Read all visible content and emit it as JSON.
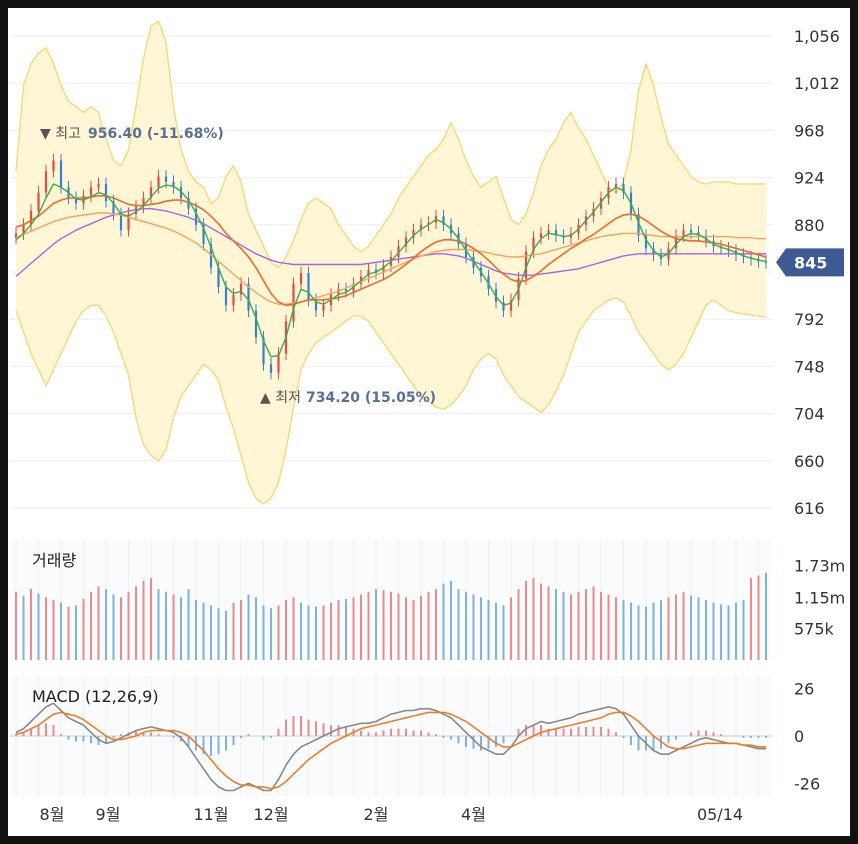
{
  "chart_data": [
    {
      "type": "candlestick",
      "panel": "price",
      "ylim": [
        616,
        1056
      ],
      "yticks": [
        "1,056",
        "1,012",
        "968",
        "924",
        "880",
        "845",
        "792",
        "748",
        "704",
        "660",
        "616"
      ],
      "current_price_label": "845",
      "current_price": 845,
      "x_months": [
        "8월",
        "9월",
        "11월",
        "12월",
        "2월",
        "4월",
        "05/14"
      ],
      "high_annotation": {
        "marker": "▼",
        "prefix": "최고",
        "value": "956.40 (-11.68%)"
      },
      "low_annotation": {
        "marker": "▲",
        "prefix": "최저",
        "value": "734.20 (15.05%)"
      },
      "close_points": [
        872,
        880,
        893,
        910,
        930,
        940,
        915,
        905,
        900,
        907,
        915,
        918,
        902,
        890,
        875,
        890,
        897,
        905,
        915,
        925,
        920,
        915,
        905,
        895,
        880,
        862,
        840,
        822,
        805,
        815,
        825,
        800,
        775,
        750,
        742,
        760,
        790,
        825,
        835,
        810,
        800,
        805,
        815,
        820,
        818,
        825,
        832,
        838,
        835,
        842,
        850,
        860,
        868,
        875,
        880,
        882,
        888,
        880,
        872,
        862,
        850,
        840,
        832,
        820,
        808,
        800,
        810,
        830,
        855,
        868,
        872,
        875,
        870,
        868,
        872,
        880,
        888,
        895,
        905,
        915,
        918,
        910,
        890,
        870,
        858,
        852,
        848,
        858,
        870,
        875,
        873,
        870,
        865,
        860,
        858,
        856,
        852,
        850,
        848,
        846,
        845
      ],
      "ma_short": [
        866,
        872,
        880,
        890,
        905,
        918,
        915,
        910,
        904,
        903,
        906,
        910,
        908,
        900,
        890,
        888,
        892,
        898,
        906,
        914,
        917,
        916,
        911,
        903,
        891,
        877,
        859,
        840,
        822,
        816,
        818,
        810,
        793,
        772,
        757,
        758,
        775,
        802,
        820,
        817,
        808,
        806,
        810,
        815,
        817,
        822,
        828,
        834,
        836,
        840,
        846,
        854,
        862,
        870,
        876,
        880,
        885,
        882,
        876,
        867,
        856,
        846,
        836,
        825,
        813,
        805,
        807,
        820,
        840,
        857,
        867,
        872,
        871,
        869,
        870,
        876,
        884,
        892,
        901,
        910,
        915,
        912,
        900,
        882,
        866,
        856,
        850,
        853,
        862,
        869,
        872,
        871,
        867,
        862,
        859,
        857,
        854,
        851,
        849,
        847,
        846
      ],
      "ma_mid": [
        878,
        880,
        884,
        888,
        894,
        900,
        903,
        905,
        905,
        905,
        906,
        907,
        907,
        905,
        902,
        899,
        898,
        898,
        899,
        900,
        902,
        903,
        903,
        901,
        898,
        894,
        888,
        881,
        872,
        865,
        858,
        850,
        840,
        828,
        816,
        808,
        805,
        806,
        808,
        810,
        810,
        810,
        811,
        812,
        814,
        817,
        820,
        823,
        826,
        829,
        833,
        838,
        843,
        849,
        855,
        860,
        864,
        866,
        866,
        865,
        862,
        858,
        853,
        847,
        840,
        834,
        829,
        827,
        828,
        832,
        837,
        843,
        848,
        853,
        858,
        862,
        867,
        871,
        876,
        881,
        886,
        889,
        890,
        888,
        884,
        879,
        874,
        870,
        867,
        866,
        865,
        865,
        864,
        863,
        862,
        860,
        858,
        856,
        854,
        852,
        850
      ],
      "ma_long": [
        868,
        871,
        874,
        877,
        880,
        883,
        885,
        887,
        888,
        889,
        890,
        891,
        891,
        890,
        889,
        887,
        885,
        883,
        881,
        879,
        877,
        874,
        871,
        867,
        863,
        858,
        852,
        846,
        840,
        834,
        828,
        822,
        817,
        812,
        808,
        806,
        806,
        807,
        808,
        810,
        812,
        814,
        816,
        818,
        821,
        824,
        827,
        830,
        833,
        836,
        839,
        842,
        845,
        848,
        851,
        853,
        855,
        856,
        857,
        857,
        857,
        856,
        855,
        854,
        852,
        851,
        850,
        850,
        851,
        852,
        853,
        855,
        857,
        859,
        861,
        863,
        865,
        867,
        869,
        870,
        871,
        872,
        872,
        872,
        871,
        870,
        869,
        869,
        869,
        869,
        869,
        869,
        869,
        869,
        869,
        869,
        868,
        868,
        868,
        867,
        867
      ],
      "ma_longest": [
        832,
        838,
        844,
        850,
        856,
        862,
        867,
        871,
        875,
        878,
        881,
        884,
        887,
        889,
        891,
        893,
        894,
        895,
        895,
        894,
        893,
        891,
        889,
        887,
        884,
        881,
        877,
        873,
        869,
        865,
        861,
        857,
        853,
        850,
        847,
        845,
        844,
        843,
        843,
        843,
        843,
        843,
        843,
        843,
        843,
        843,
        843,
        844,
        845,
        846,
        847,
        848,
        849,
        850,
        851,
        852,
        853,
        853,
        852,
        851,
        849,
        846,
        843,
        840,
        837,
        835,
        834,
        833,
        833,
        833,
        834,
        835,
        836,
        837,
        838,
        839,
        841,
        843,
        845,
        847,
        849,
        851,
        852,
        853,
        853,
        853,
        853,
        853,
        853,
        853,
        853,
        853,
        853,
        853,
        853,
        853,
        853,
        853,
        853,
        853,
        853
      ],
      "bb_upper": [
        930,
        1010,
        1030,
        1040,
        1045,
        1030,
        1010,
        995,
        990,
        985,
        990,
        985,
        960,
        940,
        935,
        950,
        990,
        1035,
        1065,
        1070,
        1050,
        990,
        950,
        930,
        920,
        915,
        900,
        905,
        925,
        935,
        920,
        890,
        875,
        860,
        845,
        840,
        850,
        865,
        885,
        900,
        905,
        900,
        895,
        880,
        870,
        860,
        855,
        860,
        870,
        880,
        890,
        905,
        915,
        925,
        935,
        945,
        950,
        960,
        975,
        960,
        940,
        925,
        915,
        920,
        925,
        905,
        885,
        880,
        890,
        910,
        935,
        950,
        960,
        975,
        985,
        970,
        960,
        945,
        930,
        915,
        910,
        920,
        950,
        1005,
        1030,
        1010,
        980,
        955,
        945,
        935,
        925,
        920,
        918,
        920,
        920,
        920,
        918,
        918,
        918,
        918,
        918
      ],
      "bb_lower": [
        800,
        780,
        760,
        745,
        730,
        745,
        760,
        775,
        790,
        800,
        805,
        805,
        795,
        780,
        760,
        740,
        700,
        675,
        665,
        660,
        670,
        700,
        720,
        730,
        740,
        750,
        745,
        735,
        710,
        690,
        665,
        640,
        625,
        620,
        625,
        640,
        670,
        710,
        745,
        760,
        770,
        775,
        780,
        785,
        790,
        795,
        795,
        790,
        780,
        770,
        760,
        750,
        740,
        730,
        720,
        715,
        710,
        708,
        712,
        720,
        730,
        745,
        755,
        760,
        755,
        740,
        730,
        720,
        715,
        710,
        705,
        712,
        725,
        740,
        760,
        780,
        790,
        800,
        805,
        810,
        812,
        808,
        795,
        780,
        770,
        760,
        750,
        745,
        750,
        760,
        775,
        790,
        805,
        810,
        805,
        800,
        798,
        797,
        796,
        795,
        794
      ]
    },
    {
      "type": "bar",
      "panel": "volume",
      "title": "거래량",
      "yticks": [
        "1.73m",
        "1.15m",
        "575k"
      ],
      "ylim": [
        0,
        2200000
      ],
      "values": [
        1250000,
        1180000,
        1300000,
        1220000,
        1150000,
        1100000,
        1050000,
        980000,
        1000000,
        1120000,
        1250000,
        1350000,
        1300000,
        1200000,
        1150000,
        1250000,
        1350000,
        1450000,
        1500000,
        1300000,
        1250000,
        1200000,
        1150000,
        1300000,
        1100000,
        1050000,
        1000000,
        950000,
        900000,
        1050000,
        1100000,
        1200000,
        1150000,
        1000000,
        950000,
        1000000,
        1100000,
        1150000,
        1050000,
        1000000,
        980000,
        1000000,
        1050000,
        1100000,
        1120000,
        1150000,
        1200000,
        1250000,
        1300000,
        1280000,
        1250000,
        1220000,
        1150000,
        1100000,
        1180000,
        1250000,
        1300000,
        1400000,
        1450000,
        1300000,
        1250000,
        1200000,
        1150000,
        1100000,
        1050000,
        1000000,
        1150000,
        1300000,
        1450000,
        1500000,
        1400000,
        1350000,
        1300000,
        1250000,
        1200000,
        1250000,
        1300000,
        1350000,
        1250000,
        1200000,
        1150000,
        1100000,
        1050000,
        1000000,
        980000,
        1050000,
        1100000,
        1150000,
        1200000,
        1250000,
        1180000,
        1150000,
        1100000,
        1050000,
        1020000,
        1000000,
        1050000,
        1100000,
        1500000,
        1550000,
        1600000
      ],
      "up": [
        true,
        false,
        true,
        false,
        true,
        true,
        false,
        true,
        false,
        true,
        true,
        true,
        false,
        false,
        true,
        true,
        true,
        true,
        true,
        false,
        false,
        true,
        false,
        false,
        false,
        false,
        false,
        false,
        false,
        true,
        true,
        false,
        false,
        false,
        false,
        true,
        true,
        true,
        false,
        false,
        false,
        true,
        true,
        true,
        false,
        true,
        true,
        true,
        false,
        true,
        true,
        true,
        true,
        true,
        true,
        true,
        true,
        false,
        false,
        false,
        false,
        false,
        false,
        false,
        false,
        false,
        true,
        true,
        true,
        true,
        true,
        true,
        false,
        false,
        true,
        true,
        true,
        true,
        true,
        true,
        true,
        false,
        false,
        false,
        false,
        false,
        false,
        true,
        true,
        true,
        false,
        false,
        false,
        false,
        false,
        false,
        false,
        false,
        true,
        true,
        false
      ]
    },
    {
      "type": "line",
      "panel": "macd",
      "title": "MACD",
      "params": "(12,26,9)",
      "yticks": [
        "26",
        "0",
        "-26"
      ],
      "ylim": [
        -33,
        33
      ],
      "macd": [
        2,
        4,
        8,
        12,
        16,
        18,
        14,
        10,
        8,
        6,
        2,
        -2,
        -4,
        -3,
        -1,
        1,
        3,
        4,
        5,
        4,
        3,
        2,
        -1,
        -6,
        -12,
        -18,
        -24,
        -28,
        -30,
        -30,
        -28,
        -26,
        -28,
        -30,
        -30,
        -24,
        -16,
        -10,
        -6,
        -4,
        -2,
        0,
        2,
        4,
        5,
        6,
        7,
        7,
        8,
        10,
        12,
        13,
        14,
        14,
        15,
        15,
        14,
        12,
        10,
        6,
        2,
        -2,
        -6,
        -8,
        -10,
        -10,
        -6,
        0,
        4,
        6,
        8,
        7,
        8,
        9,
        10,
        12,
        13,
        14,
        15,
        16,
        15,
        12,
        6,
        0,
        -4,
        -8,
        -10,
        -10,
        -8,
        -6,
        -4,
        -2,
        -1,
        -2,
        -3,
        -4,
        -4,
        -5,
        -6,
        -7,
        -7
      ],
      "signal": [
        1,
        2,
        4,
        6,
        9,
        12,
        13,
        12,
        11,
        9,
        6,
        3,
        0,
        -2,
        -2,
        -1,
        0,
        2,
        3,
        3,
        3,
        3,
        2,
        0,
        -4,
        -8,
        -13,
        -18,
        -22,
        -25,
        -27,
        -27,
        -28,
        -28,
        -29,
        -28,
        -25,
        -21,
        -17,
        -13,
        -10,
        -7,
        -4,
        -2,
        0,
        2,
        4,
        5,
        6,
        7,
        8,
        9,
        10,
        11,
        12,
        13,
        13,
        13,
        12,
        10,
        8,
        5,
        2,
        -1,
        -4,
        -6,
        -6,
        -4,
        -2,
        0,
        2,
        3,
        4,
        5,
        6,
        7,
        8,
        9,
        10,
        12,
        13,
        13,
        11,
        8,
        4,
        0,
        -3,
        -6,
        -7,
        -7,
        -6,
        -5,
        -4,
        -4,
        -4,
        -4,
        -4,
        -5,
        -5,
        -6,
        -6
      ],
      "histogram": [
        1,
        2,
        4,
        6,
        7,
        6,
        1,
        -2,
        -3,
        -3,
        -4,
        -5,
        -4,
        -1,
        1,
        2,
        3,
        2,
        2,
        1,
        0,
        -1,
        -3,
        -6,
        -8,
        -10,
        -11,
        -10,
        -8,
        -5,
        -1,
        1,
        0,
        -2,
        -1,
        4,
        9,
        11,
        11,
        9,
        8,
        7,
        6,
        6,
        5,
        4,
        3,
        2,
        2,
        3,
        4,
        4,
        4,
        3,
        3,
        2,
        1,
        -1,
        -2,
        -4,
        -6,
        -7,
        -8,
        -7,
        -6,
        -4,
        0,
        4,
        6,
        6,
        6,
        4,
        4,
        4,
        4,
        5,
        5,
        5,
        5,
        4,
        2,
        -1,
        -5,
        -8,
        -8,
        -8,
        -7,
        -4,
        -2,
        0,
        2,
        3,
        3,
        2,
        1,
        0,
        0,
        -1,
        -1,
        -1,
        -1
      ]
    }
  ],
  "colors": {
    "up": "#e24b4b",
    "down": "#3a7fd4",
    "up_vol": "#f08a8a",
    "down_vol": "#7fb0e8",
    "bb_fill": "#fff6d6",
    "bb_line": "#f5d76e",
    "ma_short": "#33b24a",
    "ma_mid": "#ee6a2a",
    "ma_long": "#f4a45e",
    "ma_longest": "#a566e0",
    "macd": "#888888",
    "signal": "#ef7d22",
    "price_tag": "#3d5a95"
  }
}
